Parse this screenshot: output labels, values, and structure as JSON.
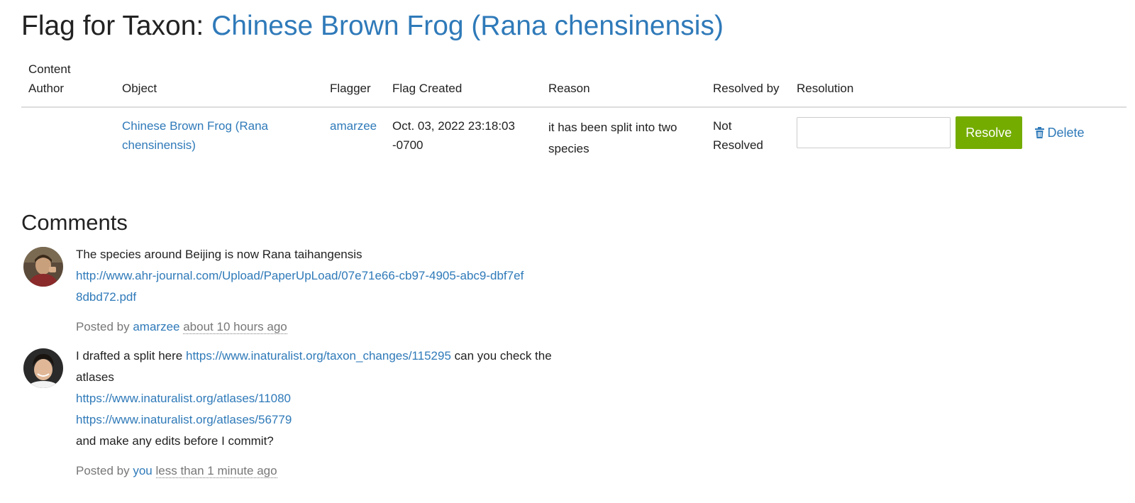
{
  "header": {
    "prefix": "Flag for Taxon: ",
    "taxon_link": "Chinese Brown Frog (Rana chensinensis)"
  },
  "table": {
    "columns": [
      "Content Author",
      "Object",
      "Flagger",
      "Flag Created",
      "Reason",
      "Resolved by",
      "Resolution"
    ],
    "row": {
      "content_author": "",
      "object": "Chinese Brown Frog (Rana chensinensis)",
      "flagger": "amarzee",
      "flag_created": "Oct. 03, 2022 23:18:03 -0700",
      "reason": "it has been split into two species",
      "resolved_by": "Not Resolved",
      "resolution_value": "",
      "resolve_label": "Resolve",
      "delete_label": "Delete"
    }
  },
  "comments_title": "Comments",
  "comments": [
    {
      "text": "The species around Beijing is now Rana taihangensis",
      "link": "http://www.ahr-journal.com/Upload/PaperUpLoad/07e71e66-cb97-4905-abc9-dbf7ef8dbd72.pdf",
      "posted_by_label": "Posted by",
      "author": "amarzee",
      "time": "about 10 hours ago"
    },
    {
      "text_before": "I drafted a split here",
      "link_change": "https://www.inaturalist.org/taxon_changes/115295",
      "text_after": "can you check the atlases",
      "link_atlas_1": "https://www.inaturalist.org/atlases/11080",
      "link_atlas_2": "https://www.inaturalist.org/atlases/56779",
      "text_end": "and make any edits before I commit?",
      "posted_by_label": "Posted by",
      "author": "you",
      "time": "less than 1 minute ago"
    }
  ],
  "colors": {
    "link": "#2f7ab9",
    "resolve_button": "#74ac00",
    "muted": "#777777"
  }
}
